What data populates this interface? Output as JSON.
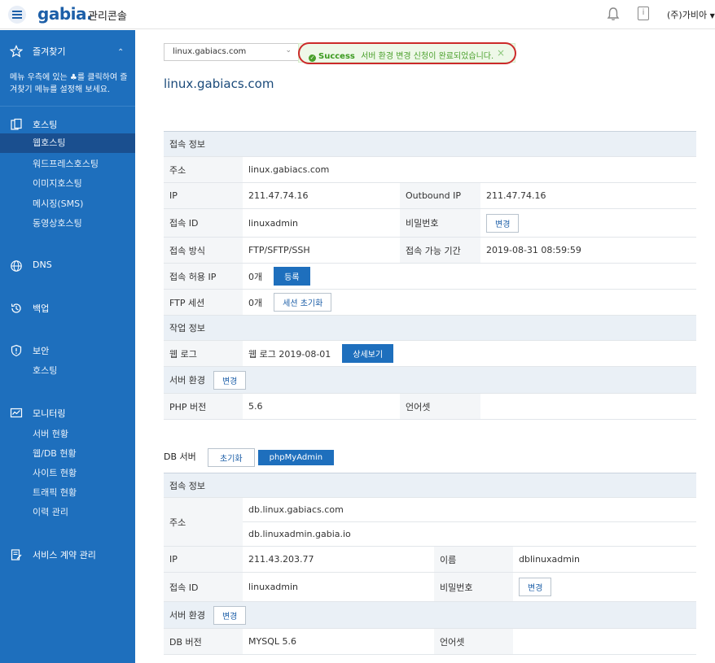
{
  "header": {
    "logo": "gabia.",
    "console_title": "관리콘솔",
    "user_name": "(주)가비아",
    "icons": [
      "menu-icon",
      "bell-icon",
      "info-icon",
      "chevron-down-icon"
    ]
  },
  "sidebar": {
    "favorites_label": "즐겨찾기",
    "favorites_note": "메뉴 우측에 있는 ♣를 클릭하여 즐겨찾기 메뉴를 설정해 보세요.",
    "hosting_label": "호스팅",
    "hosting_items": [
      "웹호스팅",
      "워드프레스호스팅",
      "이미지호스팅",
      "메시징(SMS)",
      "동영상호스팅"
    ],
    "dns_label": "DNS",
    "backup_label": "백업",
    "security_label": "보안",
    "security_items": [
      "호스팅"
    ],
    "monitoring_label": "모니터링",
    "monitoring_items": [
      "서버 현황",
      "웹/DB 현황",
      "사이트 현황",
      "트래픽 현황",
      "이력 관리"
    ],
    "contract_label": "서비스 계약 관리"
  },
  "main": {
    "select_value": "linux.gabiacs.com",
    "toast_status": "Success",
    "toast_message": "서버 환경 변경 신청이 완료되었습니다.",
    "page_title": "linux.gabiacs.com",
    "web": {
      "conn_info": "접속 정보",
      "addr_label": "주소",
      "addr_value": "linux.gabiacs.com",
      "ip_label": "IP",
      "ip_value": "211.47.74.16",
      "out_ip_label": "Outbound IP",
      "out_ip_value": "211.47.74.16",
      "id_label": "접속 ID",
      "id_value": "linuxadmin",
      "pw_label": "비밀번호",
      "pw_btn": "변경",
      "method_label": "접속 방식",
      "method_value": "FTP/SFTP/SSH",
      "period_label": "접속 가능 기간",
      "period_value": "2019-08-31 08:59:59",
      "allow_ip_label": "접속 허용 IP",
      "allow_ip_value": "0개",
      "allow_ip_btn": "등록",
      "ftp_label": "FTP 세션",
      "ftp_value": "0개",
      "ftp_btn": "세션 초기화",
      "work_info": "작업 정보",
      "weblog_label": "웹 로그",
      "weblog_value": "웹 로그 2019-08-01",
      "weblog_btn": "상세보기",
      "env_label": "서버 환경",
      "env_btn": "변경",
      "php_label": "PHP 버전",
      "php_value": "5.6",
      "charset_label": "언어셋",
      "charset_value": ""
    },
    "db": {
      "title": "DB 서버",
      "reset_btn": "초기화",
      "pma_btn": "phpMyAdmin",
      "conn_info": "접속 정보",
      "addr_label": "주소",
      "addr_value1": "db.linux.gabiacs.com",
      "addr_value2": "db.linuxadmin.gabia.io",
      "ip_label": "IP",
      "ip_value": "211.43.203.77",
      "name_label": "이름",
      "name_value": "dblinuxadmin",
      "id_label": "접속 ID",
      "id_value": "linuxadmin",
      "pw_label": "비밀번호",
      "pw_btn": "변경",
      "env_label": "서버 환경",
      "env_btn": "변경",
      "ver_label": "DB 버전",
      "ver_value": "MYSQL 5.6",
      "charset_label": "언어셋",
      "charset_value": ""
    }
  }
}
